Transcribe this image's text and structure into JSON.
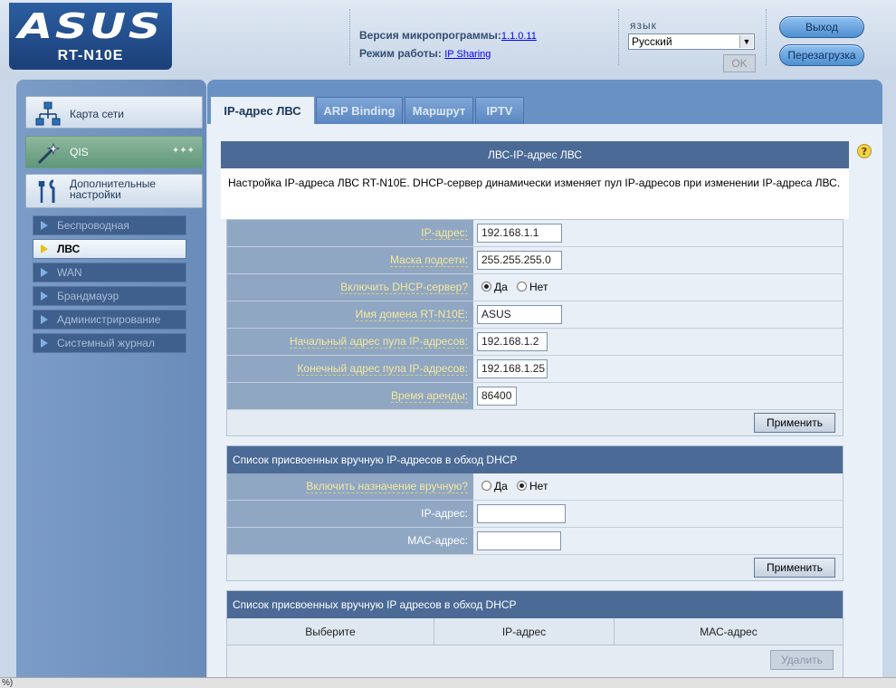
{
  "header": {
    "logo": "ASUS",
    "model": "RT-N10E",
    "firmware_label": "Версия микропрограммы:",
    "firmware_value": "1.1.0.11",
    "mode_label": "Режим работы:",
    "mode_value": "IP Sharing",
    "language_label": "язык",
    "language_selected": "Русский",
    "ok_label": "OK",
    "logout_label": "Выход",
    "reboot_label": "Перезагрузка"
  },
  "sidebar": {
    "main_items": [
      {
        "label": "Карта сети",
        "icon": "network-map-icon"
      },
      {
        "label": "QIS",
        "icon": "magic-wand-icon"
      },
      {
        "label": "Дополнительные настройки",
        "icon": "tools-icon"
      }
    ],
    "sub_items": [
      {
        "label": "Беспроводная",
        "active": false
      },
      {
        "label": "ЛВС",
        "active": true
      },
      {
        "label": "WAN",
        "active": false
      },
      {
        "label": "Брандмауэр",
        "active": false
      },
      {
        "label": "Администрирование",
        "active": false
      },
      {
        "label": "Системный журнал",
        "active": false
      }
    ]
  },
  "tabs": [
    {
      "label": "IP-адрес ЛВС",
      "active": true
    },
    {
      "label": "ARP Binding",
      "active": false
    },
    {
      "label": "Маршрут",
      "active": false
    },
    {
      "label": "IPTV",
      "active": false
    }
  ],
  "main": {
    "title": "ЛВС-IP-адрес ЛВС",
    "description": "Настройка IP-адреса ЛВС RT-N10E. DHCP-сервер динамически изменяет пул IP-адресов при изменении IP-адреса ЛВС.",
    "lan_form": {
      "ip_label": "IP-адрес:",
      "ip_value": "192.168.1.1",
      "mask_label": "Маска подсети:",
      "mask_value": "255.255.255.0",
      "dhcp_label": "Включить DHCP-сервер?",
      "dhcp_yes": "Да",
      "dhcp_no": "Нет",
      "dhcp_enabled": true,
      "domain_label": "Имя домена RT-N10E:",
      "domain_value": "ASUS",
      "pool_start_label": "Начальный адрес пула IP-адресов:",
      "pool_start_value": "192.168.1.2",
      "pool_end_label": "Конечный адрес пула IP-адресов:",
      "pool_end_value": "192.168.1.25",
      "lease_label": "Время аренды:",
      "lease_value": "86400",
      "apply_label": "Применить"
    },
    "manual_form": {
      "title": "Список присвоенных вручную IP-адресов в обход DHCP",
      "enable_label": "Включить назначение вручную?",
      "enable_yes": "Да",
      "enable_no": "Нет",
      "enabled": false,
      "ip_label": "IP-адрес:",
      "ip_value": "",
      "mac_label": "МАС-адрес:",
      "mac_value": "",
      "apply_label": "Применить"
    },
    "manual_list": {
      "title": "Список присвоенных вручную IP адресов в обход DHCP",
      "columns": [
        "Выберите",
        "IP-адрес",
        "МАС-адрес"
      ],
      "delete_label": "Удалить"
    }
  },
  "status_bar": {
    "text": "%)"
  },
  "colors": {
    "header_bg": "#c7d5e6",
    "logo_bg": "#1b3f78",
    "panel_title": "#4b6a96",
    "form_label_bg": "#90a7c4",
    "form_label_text": "#f4e89a"
  }
}
